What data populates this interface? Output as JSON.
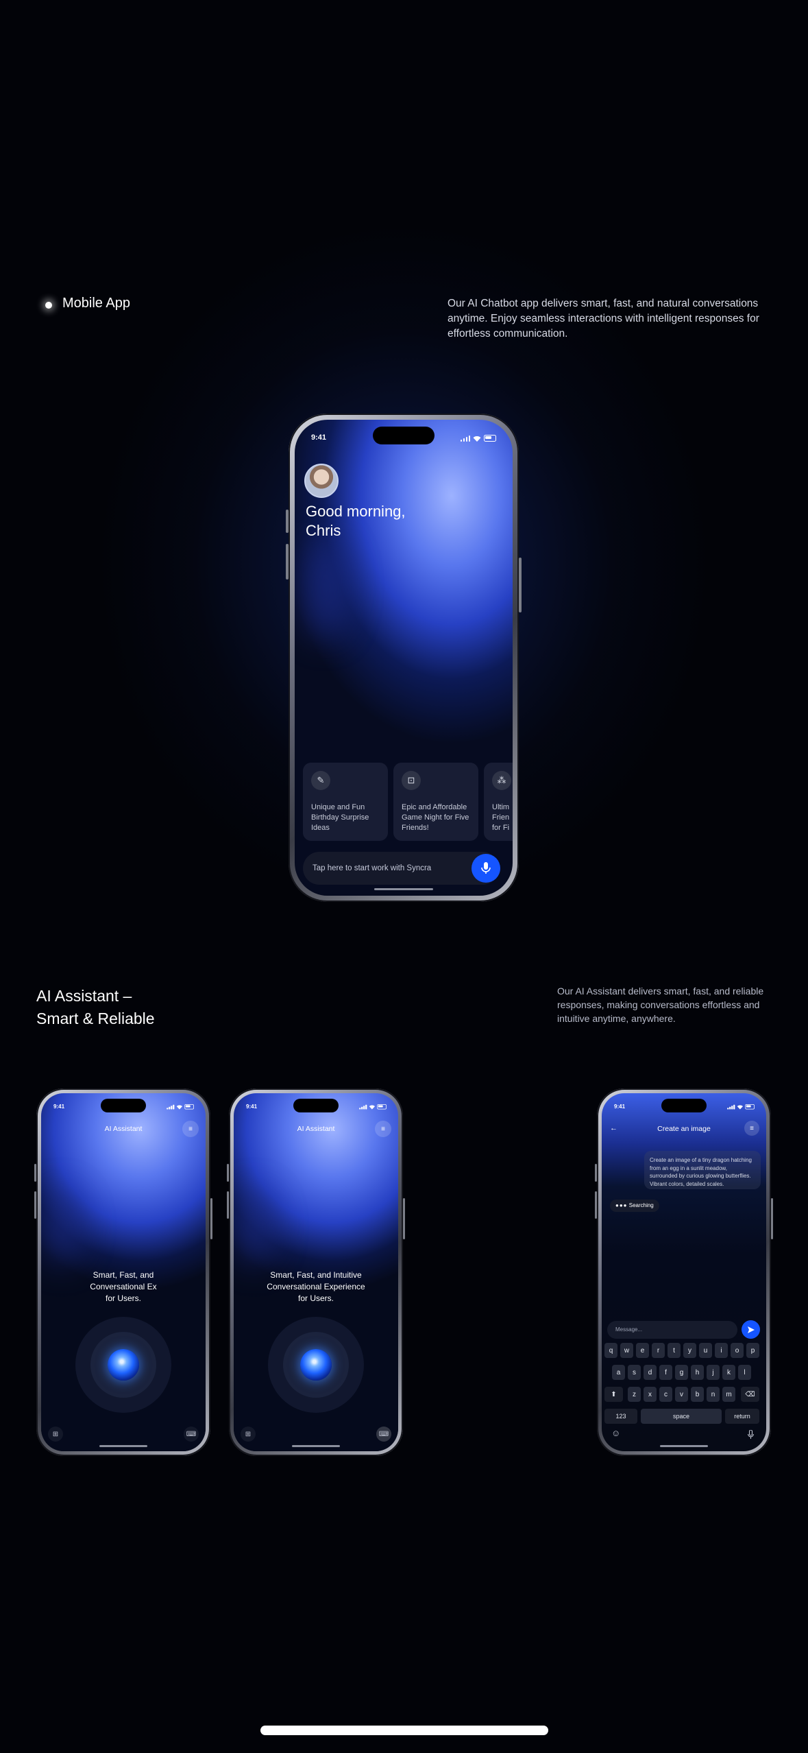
{
  "section1": {
    "label": "Mobile App",
    "description": "Our AI Chatbot app delivers smart, fast, and natural conversations anytime. Enjoy seamless interactions with intelligent responses for effortless communication."
  },
  "main_phone": {
    "time": "9:41",
    "greeting_line1": "Good morning,",
    "greeting_line2": "Chris",
    "cards": [
      {
        "icon": "gift-icon",
        "text": "Unique and Fun Birthday Surprise Ideas"
      },
      {
        "icon": "game-icon",
        "text": "Epic and Affordable Game Night for Five Friends!"
      },
      {
        "icon": "group-icon",
        "text": "Ultim Frien for Fi"
      }
    ],
    "input_placeholder": "Tap here to start work with Syncra",
    "mic_icon": "mic-icon"
  },
  "section2": {
    "title_line1": "AI Assistant –",
    "title_line2": "Smart & Reliable",
    "description": "Our AI Assistant delivers smart, fast, and reliable responses, making conversations effortless and intuitive anytime, anywhere."
  },
  "assistant_phones": [
    {
      "time": "9:41",
      "title": "AI Assistant",
      "tagline_line1": "Smart, Fast, and",
      "tagline_line2": "Conversational Ex",
      "tagline_line3": "for Users."
    },
    {
      "time": "9:41",
      "title": "AI Assistant",
      "tagline_line1": "Smart, Fast, and Intuitive",
      "tagline_line2": "Conversational Experience",
      "tagline_line3": "for Users."
    }
  ],
  "chat_phone": {
    "time": "9:41",
    "title": "Create an image",
    "user_message": "Create an image of a tiny dragon hatching from an egg in a sunlit meadow, surrounded by curious glowing butterflies. Vibrant colors, detailed scales.",
    "status": "Searching",
    "message_placeholder": "Message...",
    "keyboard": {
      "row1": [
        "q",
        "w",
        "e",
        "r",
        "t",
        "y",
        "u",
        "i",
        "o",
        "p"
      ],
      "row2": [
        "a",
        "s",
        "d",
        "f",
        "g",
        "h",
        "j",
        "k",
        "l"
      ],
      "row3": [
        "z",
        "x",
        "c",
        "v",
        "b",
        "n",
        "m"
      ],
      "numbers_key": "123",
      "space_key": "space",
      "return_key": "return"
    }
  },
  "colors": {
    "background": "#020308",
    "accent": "#1555ff",
    "screen_gradient": "#5977ee"
  }
}
